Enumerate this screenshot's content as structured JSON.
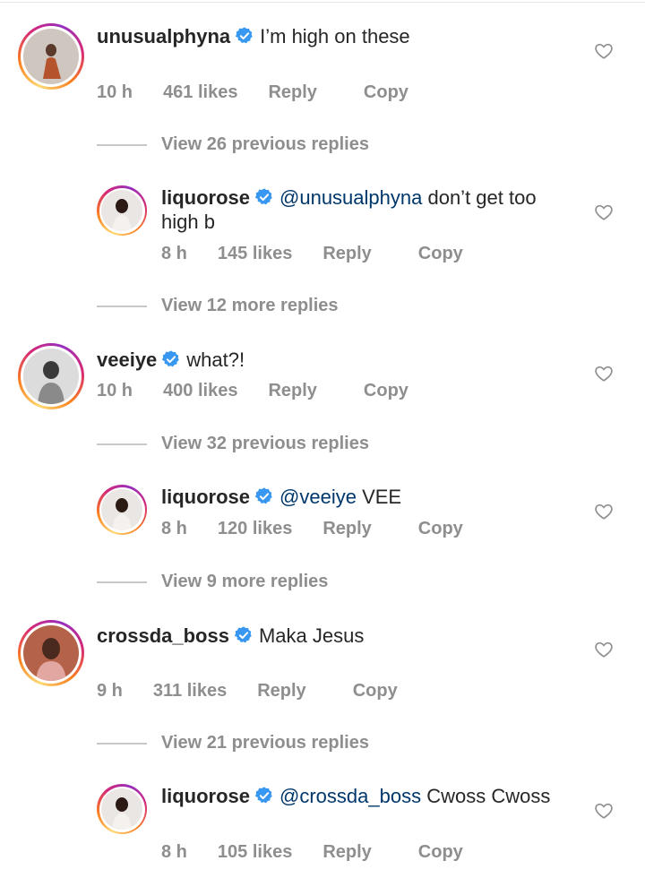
{
  "comments": [
    {
      "username": "unusualphyna",
      "text": "I’m high on these",
      "time": "10 h",
      "likes": "461 likes",
      "reply_label": "Reply",
      "copy_label": "Copy",
      "view_label": "View 26 previous replies",
      "reply": {
        "username": "liquorose",
        "mention": "@unusualphyna",
        "text": " don’t get too high b",
        "time": "8 h",
        "likes": "145 likes",
        "reply_label": "Reply",
        "copy_label": "Copy"
      },
      "more_label": "View 12 more replies"
    },
    {
      "username": "veeiye",
      "text": "what?!",
      "time": "10 h",
      "likes": "400 likes",
      "reply_label": "Reply",
      "copy_label": "Copy",
      "view_label": "View 32 previous replies",
      "reply": {
        "username": "liquorose",
        "mention": "@veeiye",
        "text": " VEE",
        "time": "8 h",
        "likes": "120 likes",
        "reply_label": "Reply",
        "copy_label": "Copy"
      },
      "more_label": "View 9 more replies"
    },
    {
      "username": "crossda_boss",
      "text": "Maka Jesus",
      "time": "9 h",
      "likes": "311 likes",
      "reply_label": "Reply",
      "copy_label": "Copy",
      "view_label": "View 21 previous replies",
      "reply": {
        "username": "liquorose",
        "mention": "@crossda_boss",
        "text": " Cwoss Cwoss",
        "time": "8 h",
        "likes": "105 likes",
        "reply_label": "Reply",
        "copy_label": "Copy"
      }
    }
  ],
  "icons": {
    "verified": "verified-badge-icon",
    "like": "heart-outline-icon"
  },
  "colors": {
    "verified": "#3897f0",
    "mention": "#00376b",
    "meta": "#8e8e8e"
  }
}
